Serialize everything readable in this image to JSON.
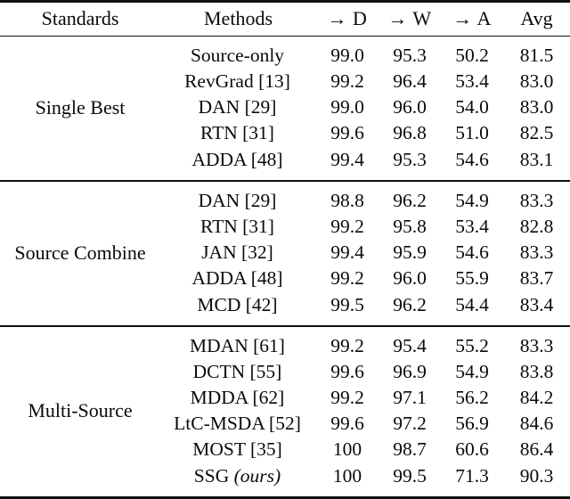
{
  "table": {
    "columns": [
      {
        "key": "standards",
        "label": "Standards"
      },
      {
        "key": "methods",
        "label": "Methods"
      },
      {
        "key": "d",
        "label": "→ D"
      },
      {
        "key": "w",
        "label": "→ W"
      },
      {
        "key": "a",
        "label": "→ A"
      },
      {
        "key": "avg",
        "label": "Avg"
      }
    ],
    "groups": [
      {
        "label": "Single Best",
        "rows": [
          {
            "method": "Source-only",
            "method_suffix": "",
            "d": "99.0",
            "w": "95.3",
            "a": "50.2",
            "avg": "81.5"
          },
          {
            "method": "RevGrad [13]",
            "method_suffix": "",
            "d": "99.2",
            "w": "96.4",
            "a": "53.4",
            "avg": "83.0"
          },
          {
            "method": "DAN [29]",
            "method_suffix": "",
            "d": "99.0",
            "w": "96.0",
            "a": "54.0",
            "avg": "83.0"
          },
          {
            "method": "RTN [31]",
            "method_suffix": "",
            "d": "99.6",
            "w": "96.8",
            "a": "51.0",
            "avg": "82.5"
          },
          {
            "method": "ADDA [48]",
            "method_suffix": "",
            "d": "99.4",
            "w": "95.3",
            "a": "54.6",
            "avg": "83.1"
          }
        ]
      },
      {
        "label": "Source Combine",
        "rows": [
          {
            "method": "DAN [29]",
            "method_suffix": "",
            "d": "98.8",
            "w": "96.2",
            "a": "54.9",
            "avg": "83.3"
          },
          {
            "method": "RTN [31]",
            "method_suffix": "",
            "d": "99.2",
            "w": "95.8",
            "a": "53.4",
            "avg": "82.8"
          },
          {
            "method": "JAN [32]",
            "method_suffix": "",
            "d": "99.4",
            "w": "95.9",
            "a": "54.6",
            "avg": "83.3"
          },
          {
            "method": "ADDA [48]",
            "method_suffix": "",
            "d": "99.2",
            "w": "96.0",
            "a": "55.9",
            "avg": "83.7"
          },
          {
            "method": "MCD [42]",
            "method_suffix": "",
            "d": "99.5",
            "w": "96.2",
            "a": "54.4",
            "avg": "83.4"
          }
        ]
      },
      {
        "label": "Multi-Source",
        "rows": [
          {
            "method": "MDAN [61]",
            "method_suffix": "",
            "d": "99.2",
            "w": "95.4",
            "a": "55.2",
            "avg": "83.3"
          },
          {
            "method": "DCTN [55]",
            "method_suffix": "",
            "d": "99.6",
            "w": "96.9",
            "a": "54.9",
            "avg": "83.8"
          },
          {
            "method": "MDDA [62]",
            "method_suffix": "",
            "d": "99.2",
            "w": "97.1",
            "a": "56.2",
            "avg": "84.2"
          },
          {
            "method": "LtC-MSDA [52]",
            "method_suffix": "",
            "d": "99.6",
            "w": "97.2",
            "a": "56.9",
            "avg": "84.6"
          },
          {
            "method": "MOST [35]",
            "method_suffix": "",
            "d": "100",
            "w": "98.7",
            "a": "60.6",
            "avg": "86.4"
          },
          {
            "method": "SSG ",
            "method_suffix": "(ours)",
            "d": "100",
            "w": "99.5",
            "a": "71.3",
            "avg": "90.3"
          }
        ]
      }
    ]
  }
}
